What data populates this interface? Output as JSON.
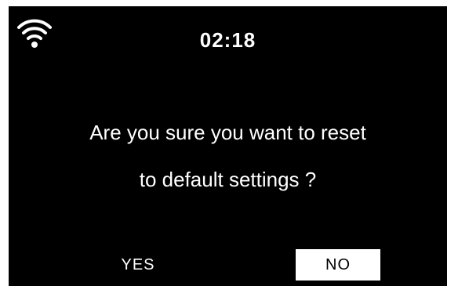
{
  "status_bar": {
    "wifi_icon": "wifi-icon",
    "time": "02:18"
  },
  "dialog": {
    "line1": "Are you sure you want to reset",
    "line2": "to default settings ?"
  },
  "options": {
    "yes_label": "YES",
    "no_label": "NO",
    "selected": "NO"
  },
  "colors": {
    "background": "#000000",
    "text": "#ffffff",
    "highlight": "#ffffff"
  }
}
